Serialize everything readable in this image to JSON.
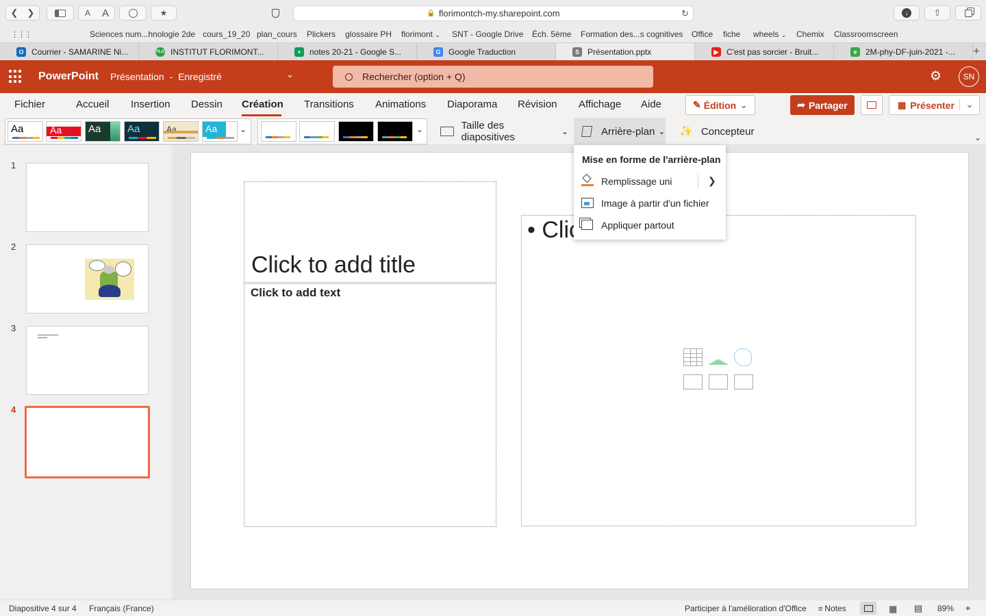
{
  "browser": {
    "url": "florimontch-my.sharepoint.com",
    "text_small": "A",
    "text_large": "A"
  },
  "favorites": [
    {
      "label": "Sciences num...hnologie 2de"
    },
    {
      "label": "cours_19_20"
    },
    {
      "label": "plan_cours"
    },
    {
      "label": "Plickers"
    },
    {
      "label": "glossaire PH"
    },
    {
      "label": "florimont"
    },
    {
      "label": "SNT - Google Drive"
    },
    {
      "label": "Éch. 5ème"
    },
    {
      "label": "Formation des...s cognitives"
    },
    {
      "label": "Office"
    },
    {
      "label": "fiche"
    },
    {
      "label": "wheels"
    },
    {
      "label": "Chemix"
    },
    {
      "label": "Classroomscreen"
    }
  ],
  "browser_tabs": [
    {
      "label": "Courrier - SAMARINE Ni...",
      "icon": "outlook-icon",
      "color": "#0f6cbd",
      "glyph": "O"
    },
    {
      "label": "INSTITUT FLORIMONT...",
      "icon": "florimont-icon",
      "color": "#2e9e45",
      "glyph": "FLO"
    },
    {
      "label": "notes 20-21 - Google S...",
      "icon": "sheets-icon",
      "color": "#0f9d58",
      "glyph": "+"
    },
    {
      "label": "Google Traduction",
      "icon": "translate-icon",
      "color": "#4285f4",
      "glyph": "G"
    },
    {
      "label": "Présentation.pptx",
      "icon": "sharepoint-icon",
      "color": "#7a7a7a",
      "glyph": "S"
    },
    {
      "label": "C'est pas sorcier - Bruit...",
      "icon": "youtube-icon",
      "color": "#e62117",
      "glyph": "▶"
    },
    {
      "label": "2M-phy-DF-juin-2021 -...",
      "icon": "leaf-icon",
      "color": "#3aa745",
      "glyph": "e"
    }
  ],
  "app": {
    "name": "PowerPoint",
    "doc_title": "Présentation",
    "separator": "-",
    "save_status": "Enregistré",
    "search_placeholder": "Rechercher (option + Q)",
    "avatar": "SN",
    "brand_color": "#c43e1c"
  },
  "ribbon_tabs": [
    {
      "label": "Fichier"
    },
    {
      "label": "Accueil"
    },
    {
      "label": "Insertion"
    },
    {
      "label": "Dessin"
    },
    {
      "label": "Création"
    },
    {
      "label": "Transitions"
    },
    {
      "label": "Animations"
    },
    {
      "label": "Diaporama"
    },
    {
      "label": "Révision"
    },
    {
      "label": "Affichage"
    },
    {
      "label": "Aide"
    }
  ],
  "active_tab": "Création",
  "ribbon_actions": {
    "edit": "Édition",
    "share": "Partager",
    "present": "Présenter"
  },
  "ribbon": {
    "theme_sample": "Aa",
    "slide_size": "Taille des diapositives",
    "background": "Arrière-plan",
    "designer": "Concepteur"
  },
  "background_menu": {
    "title": "Mise en forme de l'arrière-plan",
    "items": [
      {
        "label": "Remplissage uni"
      },
      {
        "label": "Image à partir d'un fichier"
      },
      {
        "label": "Appliquer partout"
      }
    ]
  },
  "slides": [
    {
      "number": "1"
    },
    {
      "number": "2"
    },
    {
      "number": "3"
    },
    {
      "number": "4"
    }
  ],
  "selected_slide": "4",
  "slide": {
    "title_placeholder": "Click to add title",
    "text_placeholder": "Click to add text",
    "content_placeholder": "• Clic"
  },
  "status": {
    "slide_info": "Diapositive 4 sur 4",
    "language": "Français (France)",
    "feedback": "Participer à l'amélioration d'Office",
    "notes": "Notes",
    "zoom": "89%"
  }
}
